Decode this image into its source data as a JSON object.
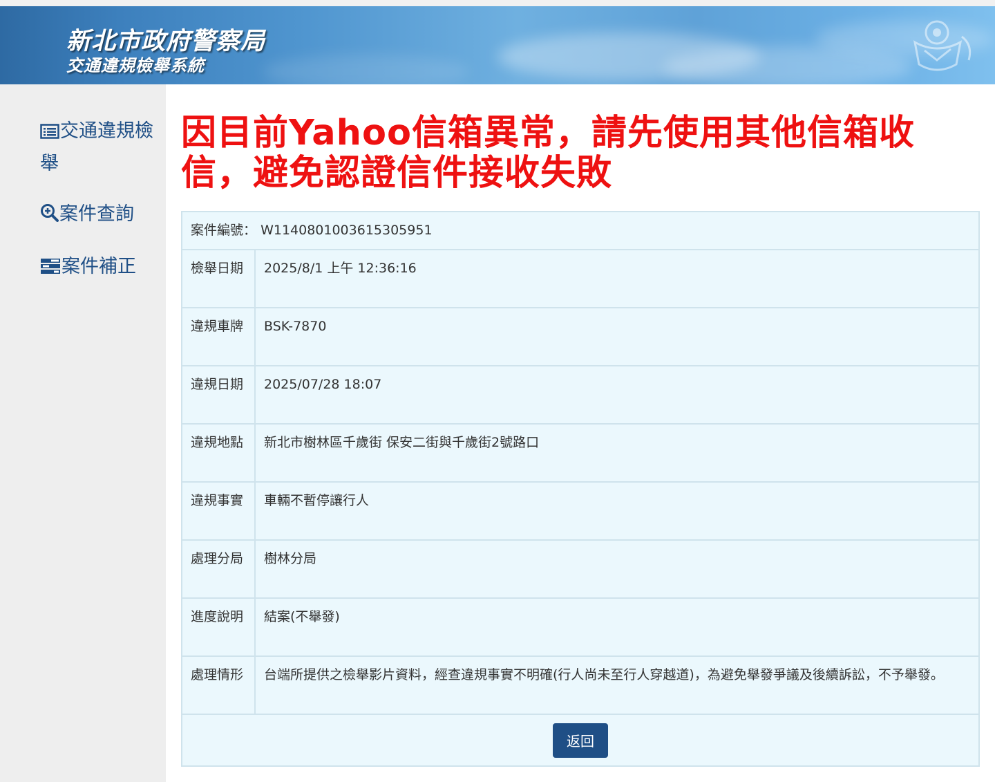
{
  "header": {
    "title": "新北市政府警察局",
    "subtitle": "交通違規檢舉系統"
  },
  "sidebar": {
    "items": [
      {
        "icon": "list-icon",
        "label": "交通違規檢舉"
      },
      {
        "icon": "search-plus-icon",
        "label": "案件查詢"
      },
      {
        "icon": "tasks-icon",
        "label": "案件補正"
      }
    ]
  },
  "notice": "因目前Yahoo信箱異常，請先使用其他信箱收信，避免認證信件接收失敗",
  "case": {
    "number_label": "案件編號：",
    "number_value": "W1140801003615305951",
    "rows": [
      {
        "label": "檢舉日期",
        "value": "2025/8/1 上午 12:36:16"
      },
      {
        "label": "違規車牌",
        "value": "BSK-7870"
      },
      {
        "label": "違規日期",
        "value": "2025/07/28 18:07"
      },
      {
        "label": "違規地點",
        "value": "新北市樹林區千歲街 保安二街與千歲街2號路口"
      },
      {
        "label": "違規事實",
        "value": "車輛不暫停讓行人"
      },
      {
        "label": "處理分局",
        "value": "樹林分局"
      },
      {
        "label": "進度說明",
        "value": "結案(不舉發)"
      },
      {
        "label": "處理情形",
        "value": "台端所提供之檢舉影片資料，經查違規事實不明確(行人尚未至行人穿越道)，為避免舉發爭議及後續訴訟，不予舉發。"
      }
    ],
    "back_label": "返回"
  },
  "colors": {
    "notice": "#ee1111",
    "nav_link": "#1f4f86",
    "table_bg": "#ebf8fd",
    "table_border": "#cfe3ec",
    "button_bg": "#1f4f86"
  }
}
